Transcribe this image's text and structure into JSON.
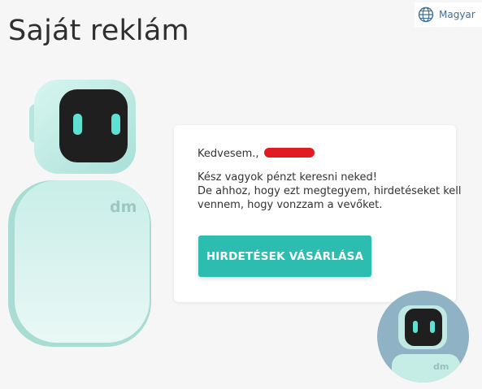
{
  "language": {
    "label": "Magyar",
    "icon": "globe-icon"
  },
  "page": {
    "title": "Saját reklám"
  },
  "card": {
    "greeting": "Kedvesem.,",
    "lines": [
      "Kész vagyok pénzt keresni neked!",
      "De ahhoz, hogy ezt megtegyem, hirdetéseket kell",
      "vennem, hogy vonzzam a vevőket."
    ],
    "button_label": "HIRDETÉSEK VÁSÁRLÁSA"
  },
  "robot_logo": "dm",
  "colors": {
    "accent": "#2dbdb0",
    "robot_body": "#c8ede7",
    "redaction": "#e01b24"
  }
}
